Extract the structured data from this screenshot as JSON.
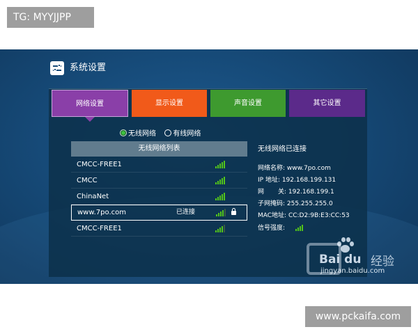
{
  "tags": {
    "top": "TG: MYYJJPP",
    "bottom": "www.pckaifa.com"
  },
  "header": {
    "title": "系统设置",
    "icon": "settings-sliders-icon"
  },
  "tabs": [
    {
      "label": "网络设置",
      "color": "#8a3fa8",
      "selected": true
    },
    {
      "label": "显示设置",
      "color": "#f15a1a",
      "selected": false
    },
    {
      "label": "声音设置",
      "color": "#3e9a2f",
      "selected": false
    },
    {
      "label": "其它设置",
      "color": "#5b2a8a",
      "selected": false
    }
  ],
  "network_type": {
    "wireless": "无线网络",
    "wired": "有线网络",
    "selected": "wireless"
  },
  "wifi_list": {
    "header": "无线网络列表",
    "items": [
      {
        "name": "CMCC-FREE1",
        "status": "",
        "signal_bars": 5,
        "locked": false,
        "selected": false
      },
      {
        "name": "CMCC",
        "status": "",
        "signal_bars": 5,
        "locked": false,
        "selected": false
      },
      {
        "name": "ChinaNet",
        "status": "",
        "signal_bars": 5,
        "locked": false,
        "selected": false
      },
      {
        "name": "www.7po.com",
        "status": "已连接",
        "signal_bars": 4,
        "locked": true,
        "selected": true
      },
      {
        "name": "CMCC-FREE1",
        "status": "",
        "signal_bars": 4,
        "locked": false,
        "selected": false
      }
    ]
  },
  "connection_info": {
    "status": "无线网络已连接",
    "name": "网络名称: www.7po.com",
    "ip": "IP 地址: 192.168.199.131",
    "gateway_label_a": "网",
    "gateway_label_b": "关: 192.168.199.1",
    "mask": "子网掩码: 255.255.255.0",
    "mac": "MAC地址: CC:D2:9B:E3:CC:53",
    "signal": "信号强度:",
    "signal_bars": 4
  },
  "watermark": {
    "brand": "Bai du",
    "jingyan": "经验",
    "url": "jingyan.baidu.com"
  },
  "colors": {
    "signal_green": "#52c41a",
    "screen_blue": "#164a78"
  }
}
